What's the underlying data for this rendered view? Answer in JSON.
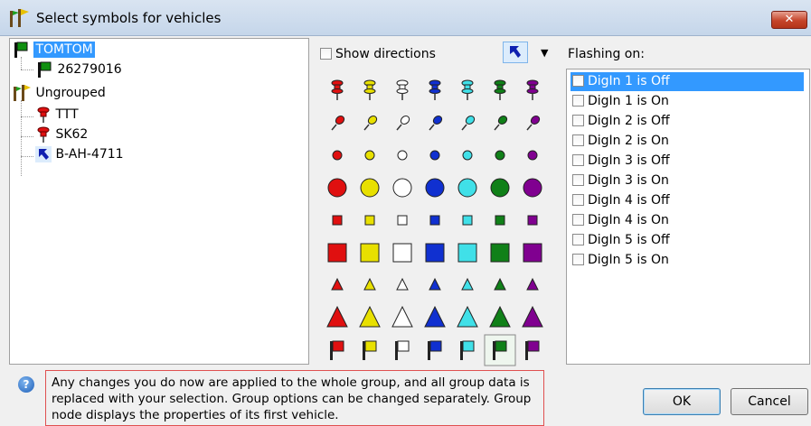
{
  "window": {
    "title": "Select symbols for vehicles",
    "close_label": "✕"
  },
  "tree": {
    "nodes": [
      {
        "label": "TOMTOM",
        "icon": "green-flag-icon",
        "selected": true
      },
      {
        "label": "26279016",
        "icon": "green-flag-icon"
      },
      {
        "label": "Ungrouped",
        "icon": "group-pins-icon"
      },
      {
        "label": "TTT",
        "icon": "red-pin-icon"
      },
      {
        "label": "SK62",
        "icon": "red-pin-icon"
      },
      {
        "label": "B-AH-4711",
        "icon": "blue-arrow-icon"
      }
    ]
  },
  "show_directions": {
    "label": "Show directions",
    "checked": false
  },
  "direction_combo": {
    "icon": "blue-arrow-icon"
  },
  "symbols": {
    "colors": [
      "#e01010",
      "#e8e000",
      "#ffffff",
      "#1030d0",
      "#40e0e8",
      "#108018",
      "#800090"
    ],
    "rows": [
      "pushpin",
      "pin",
      "small-circle",
      "large-circle",
      "small-square",
      "large-square",
      "small-triangle",
      "large-triangle",
      "flag"
    ]
  },
  "flashing": {
    "label": "Flashing on:",
    "items": [
      {
        "label": "DigIn 1 is Off",
        "selected": true
      },
      {
        "label": "DigIn 1 is On"
      },
      {
        "label": "DigIn 2 is Off"
      },
      {
        "label": "DigIn 2 is On"
      },
      {
        "label": "DigIn 3 is Off"
      },
      {
        "label": "DigIn 3 is On"
      },
      {
        "label": "DigIn 4 is Off"
      },
      {
        "label": "DigIn 4 is On"
      },
      {
        "label": "DigIn 5 is Off"
      },
      {
        "label": "DigIn 5 is On"
      }
    ]
  },
  "notice": {
    "text": "Any changes you do now are applied to the whole group, and all group data is replaced with your selection. Group options can be changed separately. Group node displays the properties of its first vehicle."
  },
  "buttons": {
    "ok": "OK",
    "cancel": "Cancel"
  }
}
